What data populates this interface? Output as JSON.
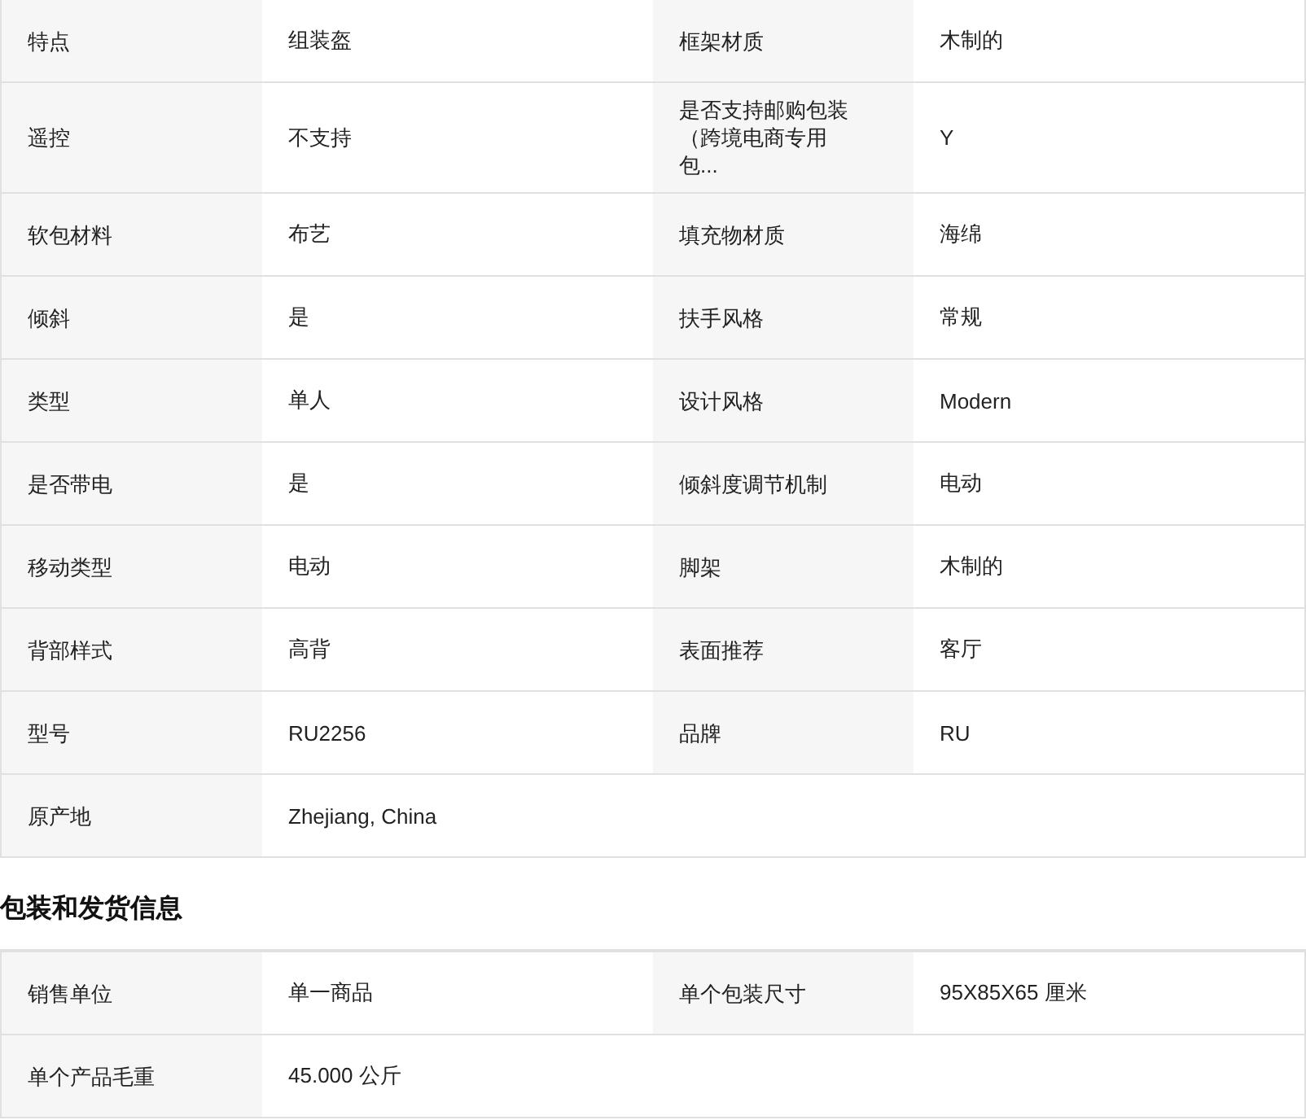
{
  "spec_table": {
    "rows": [
      {
        "cells": [
          {
            "label": "特点",
            "value": "组装盔"
          },
          {
            "label": "框架材质",
            "value": "木制的"
          }
        ]
      },
      {
        "cells": [
          {
            "label": "遥控",
            "value": "不支持"
          },
          {
            "label": "是否支持邮购包装（跨境电商专用包...",
            "value": "Y"
          }
        ]
      },
      {
        "cells": [
          {
            "label": "软包材料",
            "value": "布艺"
          },
          {
            "label": "填充物材质",
            "value": "海绵"
          }
        ]
      },
      {
        "cells": [
          {
            "label": "倾斜",
            "value": "是"
          },
          {
            "label": "扶手风格",
            "value": "常规"
          }
        ]
      },
      {
        "cells": [
          {
            "label": "类型",
            "value": "单人"
          },
          {
            "label": "设计风格",
            "value": "Modern"
          }
        ]
      },
      {
        "cells": [
          {
            "label": "是否带电",
            "value": "是"
          },
          {
            "label": "倾斜度调节机制",
            "value": "电动"
          }
        ]
      },
      {
        "cells": [
          {
            "label": "移动类型",
            "value": "电动"
          },
          {
            "label": "脚架",
            "value": "木制的"
          }
        ]
      },
      {
        "cells": [
          {
            "label": "背部样式",
            "value": "高背"
          },
          {
            "label": "表面推荐",
            "value": "客厅"
          }
        ]
      },
      {
        "cells": [
          {
            "label": "型号",
            "value": "RU2256"
          },
          {
            "label": "品牌",
            "value": "RU"
          }
        ]
      },
      {
        "cells": [
          {
            "label": "原产地",
            "value": "Zhejiang, China"
          }
        ]
      }
    ]
  },
  "packaging": {
    "title": "包装和发货信息",
    "rows": [
      {
        "cells": [
          {
            "label": "销售单位",
            "value": "单一商品"
          },
          {
            "label": "单个包装尺寸",
            "value": "95X85X65 厘米"
          }
        ]
      },
      {
        "cells": [
          {
            "label": "单个产品毛重",
            "value": "45.000 公斤"
          }
        ]
      }
    ]
  }
}
